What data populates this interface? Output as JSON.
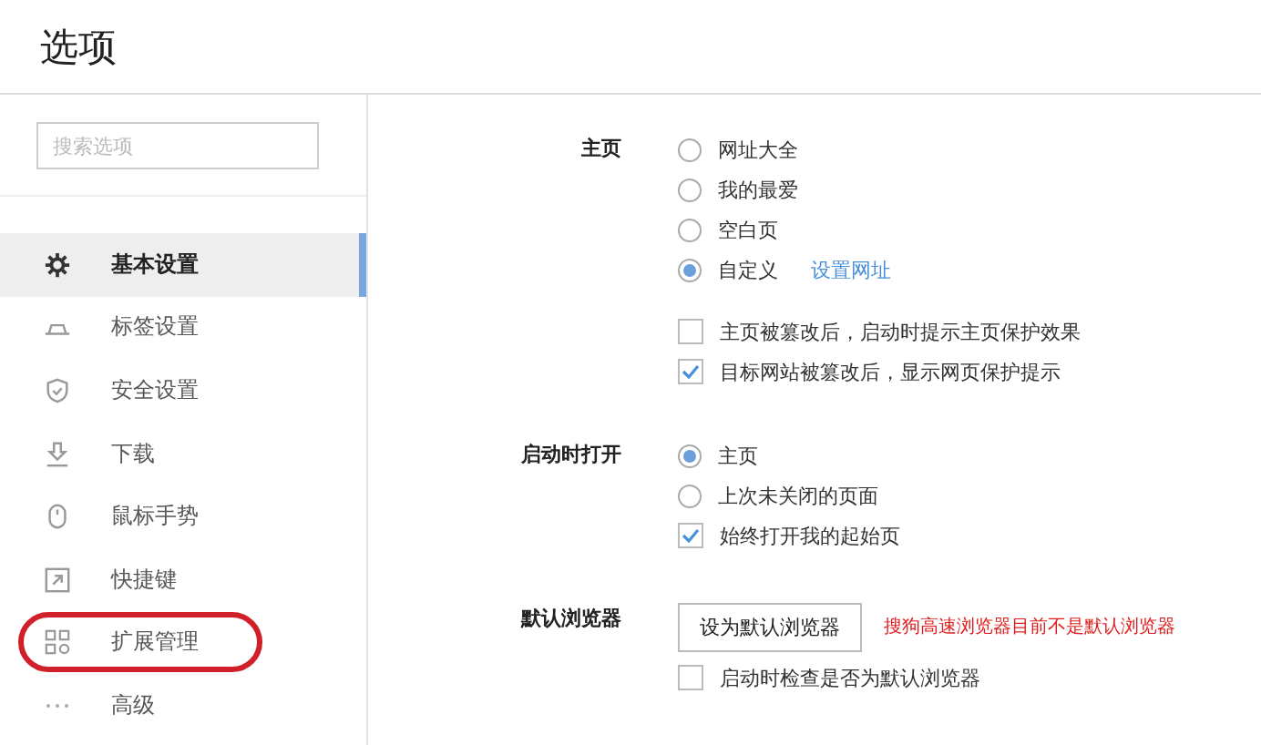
{
  "window": {
    "title": "选项"
  },
  "search": {
    "placeholder": "搜索选项"
  },
  "sidebar": {
    "items": [
      {
        "label": "基本设置",
        "selected": true,
        "circled": false
      },
      {
        "label": "标签设置",
        "selected": false,
        "circled": false
      },
      {
        "label": "安全设置",
        "selected": false,
        "circled": false
      },
      {
        "label": "下载",
        "selected": false,
        "circled": false
      },
      {
        "label": "鼠标手势",
        "selected": false,
        "circled": false
      },
      {
        "label": "快捷键",
        "selected": false,
        "circled": false
      },
      {
        "label": "扩展管理",
        "selected": false,
        "circled": true
      },
      {
        "label": "高级",
        "selected": false,
        "circled": false
      }
    ]
  },
  "sections": [
    {
      "label": "主页",
      "rows": [
        {
          "kind": "radio",
          "label": "网址大全",
          "selected": false
        },
        {
          "kind": "radio",
          "label": "我的最爱",
          "selected": false
        },
        {
          "kind": "radio",
          "label": "空白页",
          "selected": false
        },
        {
          "kind": "radio",
          "label": "自定义",
          "selected": true,
          "link": "设置网址"
        },
        {
          "kind": "gap"
        },
        {
          "kind": "checkbox",
          "label": "主页被篡改后，启动时提示主页保护效果",
          "checked": false
        },
        {
          "kind": "checkbox",
          "label": "目标网站被篡改后，显示网页保护提示",
          "checked": true
        }
      ]
    },
    {
      "label": "启动时打开",
      "rows": [
        {
          "kind": "radio",
          "label": "主页",
          "selected": true
        },
        {
          "kind": "radio",
          "label": "上次未关闭的页面",
          "selected": false
        },
        {
          "kind": "checkbox",
          "label": "始终打开我的起始页",
          "checked": true
        }
      ]
    },
    {
      "label": "默认浏览器",
      "rows": [
        {
          "kind": "button",
          "label": "设为默认浏览器",
          "note": "搜狗高速浏览器目前不是默认浏览器"
        },
        {
          "kind": "checkbox",
          "label": "启动时检查是否为默认浏览器",
          "checked": false
        }
      ]
    }
  ]
}
